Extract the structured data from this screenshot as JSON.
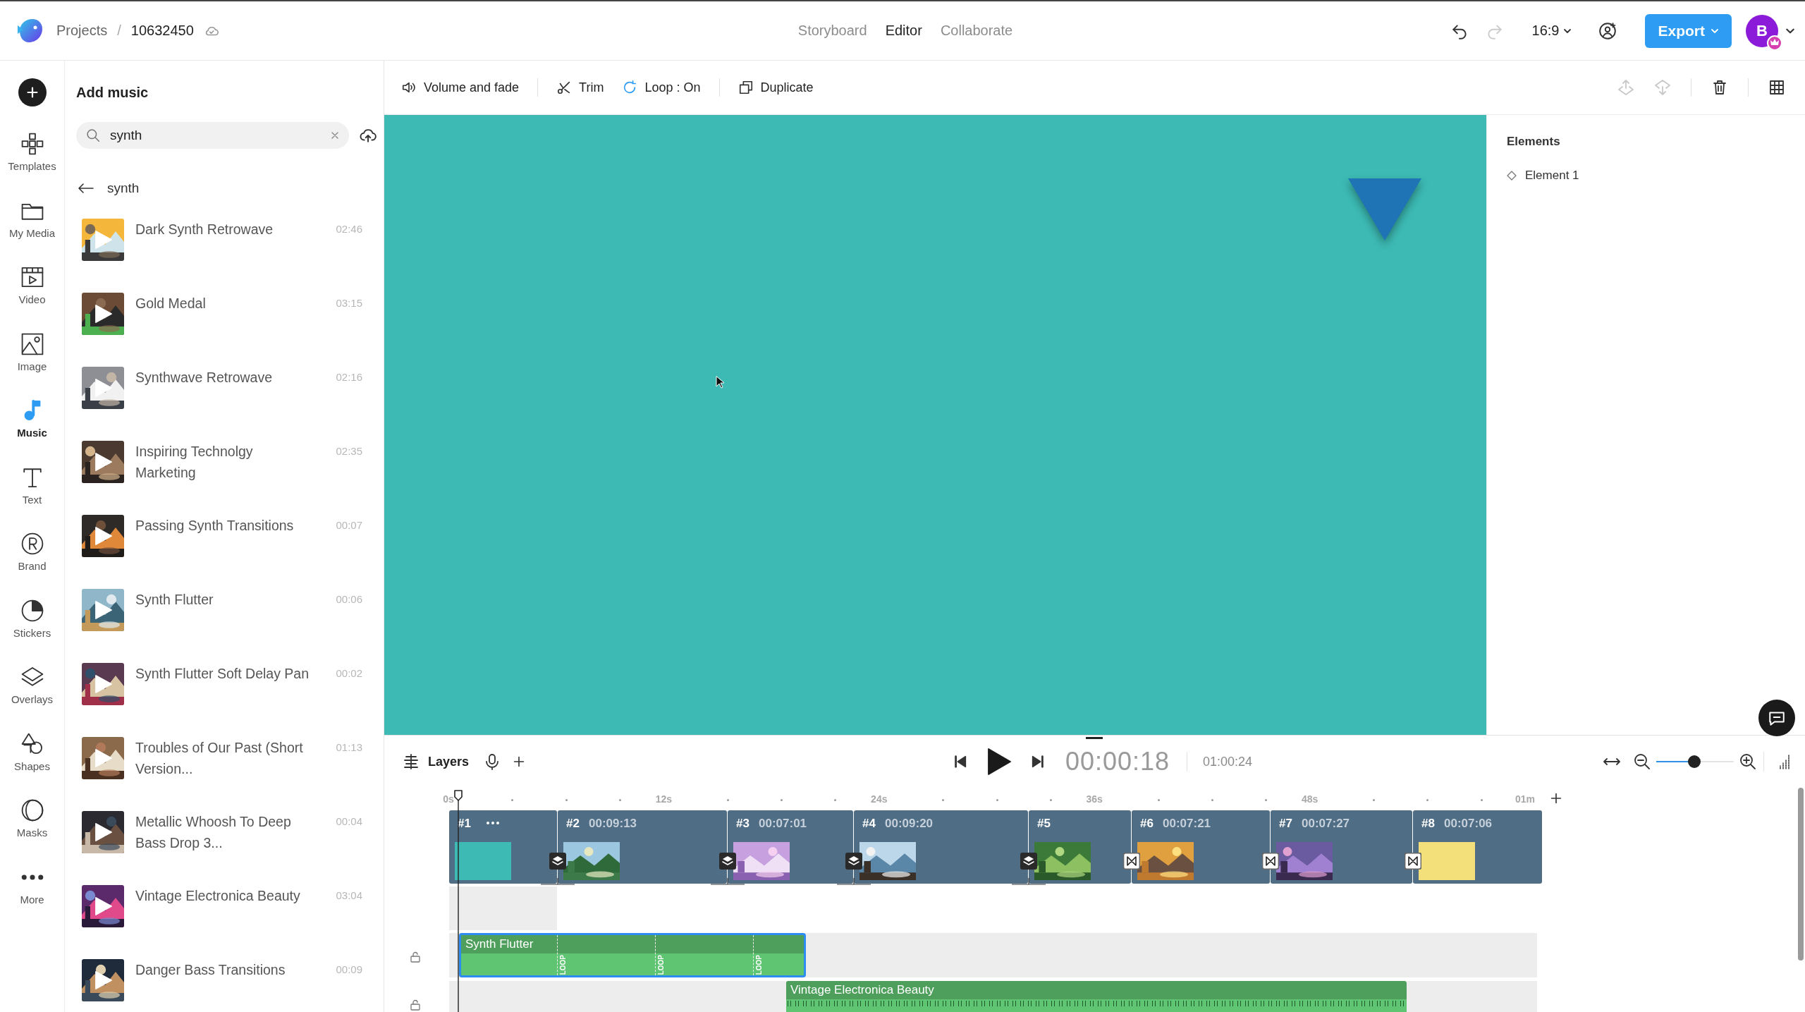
{
  "header": {
    "breadcrumb": {
      "items": [
        "Projects",
        "10632450"
      ],
      "separator": "/"
    },
    "nav": [
      {
        "label": "Storyboard",
        "selected": false
      },
      {
        "label": "Editor",
        "selected": true
      },
      {
        "label": "Collaborate",
        "selected": false
      }
    ],
    "undo": {
      "disabled": false
    },
    "redo": {
      "disabled": true
    },
    "aspect_ratio": "16:9",
    "export_button": "Export",
    "avatar": "B"
  },
  "rail": {
    "items": [
      {
        "label": "Templates",
        "selected": false
      },
      {
        "label": "My Media",
        "selected": false
      },
      {
        "label": "Video",
        "selected": false
      },
      {
        "label": "Image",
        "selected": false
      },
      {
        "label": "Music",
        "selected": true
      },
      {
        "label": "Text",
        "selected": false
      },
      {
        "label": "Brand",
        "selected": false
      },
      {
        "label": "Stickers",
        "selected": false
      },
      {
        "label": "Overlays",
        "selected": false
      },
      {
        "label": "Shapes",
        "selected": false
      },
      {
        "label": "Masks",
        "selected": false
      },
      {
        "label": "More",
        "selected": false
      }
    ]
  },
  "music_panel": {
    "title": "Add music",
    "search": {
      "value": "synth"
    },
    "back_label": "synth",
    "tracks": [
      {
        "title": "Dark Synth Retrowave",
        "duration": "02:46"
      },
      {
        "title": "Gold Medal",
        "duration": "03:15"
      },
      {
        "title": "Synthwave Retrowave",
        "duration": "02:16"
      },
      {
        "title": "Inspiring Technolgy Marketing",
        "duration": "02:35"
      },
      {
        "title": "Passing Synth Transitions",
        "duration": "00:07"
      },
      {
        "title": "Synth Flutter",
        "duration": "00:06"
      },
      {
        "title": "Synth Flutter Soft Delay Pan",
        "duration": "00:02"
      },
      {
        "title": "Troubles of Our Past (Short Version...",
        "duration": "01:13"
      },
      {
        "title": "Metallic Whoosh To Deep Bass Drop 3...",
        "duration": "00:04"
      },
      {
        "title": "Vintage Electronica Beauty",
        "duration": "03:04"
      },
      {
        "title": "Danger Bass Transitions",
        "duration": "00:09"
      }
    ]
  },
  "toolbar": {
    "buttons": [
      "Volume and fade",
      "Trim",
      "Loop : On",
      "Duplicate"
    ],
    "layer_up": {
      "disabled": true
    },
    "layer_down": {
      "disabled": true
    }
  },
  "elements_panel": {
    "title": "Elements",
    "items": [
      {
        "label": "Element 1"
      }
    ]
  },
  "timeline": {
    "layers_label": "Layers",
    "current_time": "00:00:18",
    "total_time": "01:00:24",
    "zoom": {
      "level": 0.49
    },
    "ruler": [
      "0s",
      "12s",
      "24s",
      "36s",
      "48s",
      "01m"
    ],
    "scenes": [
      {
        "label": "#1",
        "kind": "color",
        "color": "#3cbab3"
      },
      {
        "label": "#2",
        "duration": "00:09:13",
        "kind": "picture"
      },
      {
        "label": "#3",
        "duration": "00:07:01",
        "kind": "picture"
      },
      {
        "label": "#4",
        "duration": "00:09:20",
        "kind": "picture"
      },
      {
        "label": "#5",
        "kind": "picture"
      },
      {
        "label": "#6",
        "duration": "00:07:21",
        "kind": "picture"
      },
      {
        "label": "#7",
        "duration": "00:07:27",
        "kind": "picture"
      },
      {
        "label": "#8",
        "duration": "00:07:06",
        "kind": "color",
        "color": "#f3e07a"
      }
    ],
    "audio_tracks": [
      {
        "clip": {
          "title": "Synth Flutter",
          "selected": true,
          "loops": [
            "LOOP",
            "LOOP",
            "LOOP"
          ]
        }
      },
      {
        "clip": {
          "title": "Vintage Electronica Beauty",
          "selected": false
        }
      }
    ]
  }
}
